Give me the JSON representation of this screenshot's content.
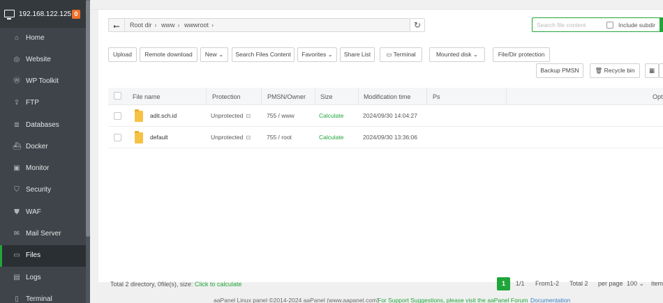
{
  "sidebar": {
    "ip": "192.168.122.125",
    "badge": "0",
    "items": [
      {
        "label": "Home",
        "icon": "home-icon",
        "glyph": "⌂"
      },
      {
        "label": "Website",
        "icon": "globe-icon",
        "glyph": "◎"
      },
      {
        "label": "WP Toolkit",
        "icon": "wordpress-icon",
        "glyph": "Ⓦ"
      },
      {
        "label": "FTP",
        "icon": "ftp-icon",
        "glyph": "⇪"
      },
      {
        "label": "Databases",
        "icon": "database-icon",
        "glyph": "≣"
      },
      {
        "label": "Docker",
        "icon": "docker-icon",
        "glyph": "⛴"
      },
      {
        "label": "Monitor",
        "icon": "monitor-icon",
        "glyph": "▣"
      },
      {
        "label": "Security",
        "icon": "shield-icon",
        "glyph": "⛉"
      },
      {
        "label": "WAF",
        "icon": "waf-icon",
        "glyph": "⛊"
      },
      {
        "label": "Mail Server",
        "icon": "mail-icon",
        "glyph": "✉"
      },
      {
        "label": "Files",
        "icon": "folder-icon",
        "glyph": "▭"
      },
      {
        "label": "Logs",
        "icon": "logs-icon",
        "glyph": "▤"
      },
      {
        "label": "Terminal",
        "icon": "terminal-icon",
        "glyph": "▯"
      }
    ],
    "active": "Files"
  },
  "path": {
    "back_glyph": "⭠",
    "refresh_glyph": "↻",
    "segments": [
      "Root dir",
      "www",
      "wwwroot"
    ]
  },
  "search": {
    "placeholder": "Search file content",
    "include_subdir": "Include subdir"
  },
  "toolbar": {
    "upload": "Upload",
    "remote_download": "Remote download",
    "new": "New",
    "search_files_content": "Search Files Content",
    "favorites": "Favorites",
    "share_list": "Share List",
    "terminal": "Terminal",
    "mounted_disk": "Mounted disk",
    "file_dir_protection": "File/Dir protection",
    "backup_pmsn": "Backup PMSN",
    "recycle_bin": "Recycle bin"
  },
  "table": {
    "headers": {
      "name": "File name",
      "protection": "Protection",
      "pmsn": "PMSN/Owner",
      "size": "Size",
      "mtime": "Modification time",
      "ps": "Ps",
      "opt": "Opt"
    },
    "rows": [
      {
        "name": "adit.sch.id",
        "protection": "Unprotected",
        "pmsn": "755 / www",
        "size": "Calculate",
        "mtime": "2024/09/30 14:04:27"
      },
      {
        "name": "default",
        "protection": "Unprotected",
        "pmsn": "755 / root",
        "size": "Calculate",
        "mtime": "2024/09/30 13:36:06"
      }
    ]
  },
  "footer": {
    "summary": "Total 2 directory, 0file(s), size:",
    "calc_link": "Click to calculate",
    "page": "1",
    "pages": "1/1",
    "range": "From1-2",
    "total": "Total 2",
    "per_page_label": "per page",
    "per_page": "100",
    "items": "item"
  },
  "copyright": {
    "text": "aaPanel Linux panel ©2014-2024 aaPanel (www.aapanel.com)",
    "support": "For Support Suggestions, please visit the aaPanel Forum",
    "docs": "Documentation"
  },
  "colors": {
    "accent": "#20a53a",
    "sidebar": "#3e4449"
  }
}
